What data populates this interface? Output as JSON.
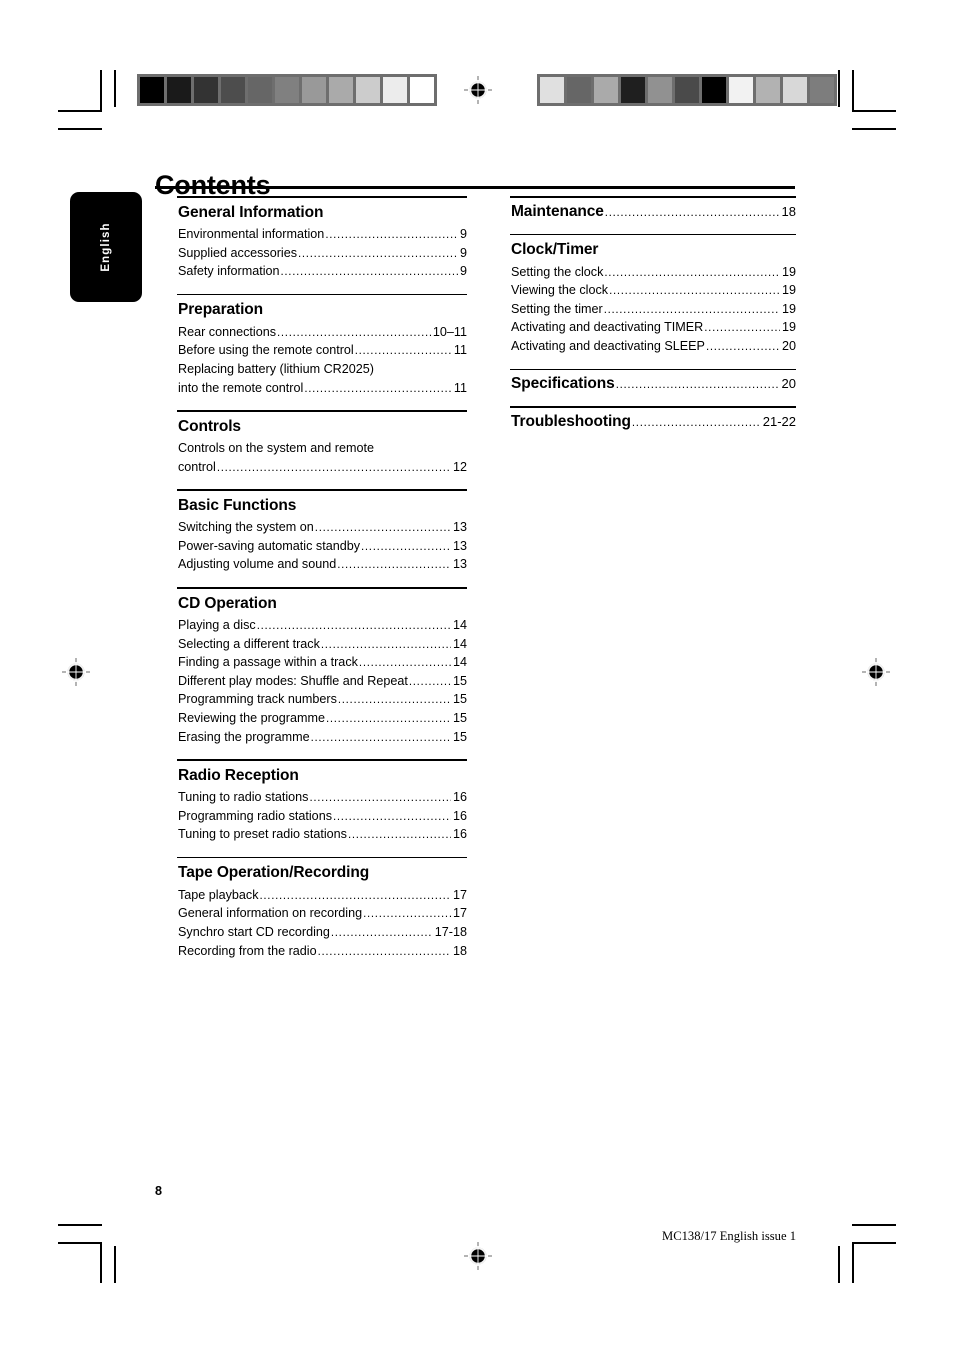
{
  "document": {
    "title": "Contents",
    "language_tab": "English",
    "page_number": "8",
    "footer_id": "MC138/17 English issue 1"
  },
  "marks": {
    "registration_icon": "registration-target-icon",
    "grayscale_wedge_left": [
      "#000000",
      "#1a1a1a",
      "#333333",
      "#4d4d4d",
      "#666666",
      "#808080",
      "#999999",
      "#aaaaaa",
      "#cccccc",
      "#ececec",
      "#ffffff"
    ],
    "grayscale_wedge_right": [
      "#e0e0e0",
      "#666666",
      "#aaaaaa",
      "#1f1f1f",
      "#919191",
      "#4a4a4a",
      "#000000",
      "#f2f2f2",
      "#b2b2b2",
      "#d8d8d8",
      "#7d7d7d"
    ]
  },
  "columns": {
    "left": [
      {
        "heading": "General Information",
        "heading_page": "",
        "entries": [
          {
            "text": "Environmental information",
            "page": "9",
            "leader": true
          },
          {
            "text": "Supplied accessories",
            "page": "9",
            "leader": true
          },
          {
            "text": "Safety information",
            "page": "9",
            "leader": true
          }
        ]
      },
      {
        "heading": "Preparation",
        "heading_page": "",
        "entries": [
          {
            "text": "Rear connections",
            "page": "10–11",
            "leader": true
          },
          {
            "text": "Before using the remote control",
            "page": "11",
            "leader": true
          },
          {
            "text": "Replacing battery (lithium CR2025)",
            "page": "",
            "leader": false
          },
          {
            "text": "into the remote control",
            "page": "11",
            "leader": true
          }
        ]
      },
      {
        "heading": "Controls",
        "heading_page": "",
        "entries": [
          {
            "text": "Controls on the system and remote",
            "page": "",
            "leader": false
          },
          {
            "text": "control",
            "page": "12",
            "leader": true
          }
        ]
      },
      {
        "heading": "Basic Functions",
        "heading_page": "",
        "entries": [
          {
            "text": "Switching the system on",
            "page": "13",
            "leader": true
          },
          {
            "text": "Power-saving automatic standby",
            "page": "13",
            "leader": true
          },
          {
            "text": "Adjusting volume and sound",
            "page": "13",
            "leader": true
          }
        ]
      },
      {
        "heading": "CD Operation",
        "heading_page": "",
        "entries": [
          {
            "text": "Playing a disc",
            "page": "14",
            "leader": true
          },
          {
            "text": "Selecting a different track",
            "page": "14",
            "leader": true
          },
          {
            "text": "Finding a passage within a track",
            "page": "14",
            "leader": true
          },
          {
            "text": "Different play modes: Shuffle and Repeat",
            "page": "15",
            "leader": true
          },
          {
            "text": "Programming track numbers",
            "page": "15",
            "leader": true
          },
          {
            "text": "Reviewing the programme",
            "page": "15",
            "leader": true
          },
          {
            "text": "Erasing the programme",
            "page": "15",
            "leader": true
          }
        ]
      },
      {
        "heading": "Radio Reception",
        "heading_page": "",
        "entries": [
          {
            "text": "Tuning to radio stations",
            "page": "16",
            "leader": true
          },
          {
            "text": "Programming radio stations",
            "page": "16",
            "leader": true
          },
          {
            "text": "Tuning to preset radio stations",
            "page": "16",
            "leader": true
          }
        ]
      },
      {
        "heading": "Tape Operation/Recording",
        "heading_page": "",
        "entries": [
          {
            "text": "Tape playback",
            "page": "17",
            "leader": true
          },
          {
            "text": "General information on recording",
            "page": "17",
            "leader": true
          },
          {
            "text": "Synchro start CD recording",
            "page": "17-18",
            "leader": true
          },
          {
            "text": "Recording from the radio",
            "page": "18",
            "leader": true
          }
        ]
      }
    ],
    "right": [
      {
        "heading": "Maintenance",
        "heading_page": "18",
        "entries": []
      },
      {
        "heading": "Clock/Timer",
        "heading_page": "",
        "entries": [
          {
            "text": "Setting the clock",
            "page": "19",
            "leader": true
          },
          {
            "text": "Viewing the clock",
            "page": "19",
            "leader": true
          },
          {
            "text": "Setting the timer",
            "page": "19",
            "leader": true
          },
          {
            "text": "Activating and deactivating TIMER",
            "page": "19",
            "leader": true
          },
          {
            "text": "Activating and deactivating SLEEP",
            "page": "20",
            "leader": true
          }
        ]
      },
      {
        "heading": "Specifications",
        "heading_page": "20",
        "entries": []
      },
      {
        "heading": "Troubleshooting",
        "heading_page": "21-22",
        "entries": []
      }
    ]
  }
}
